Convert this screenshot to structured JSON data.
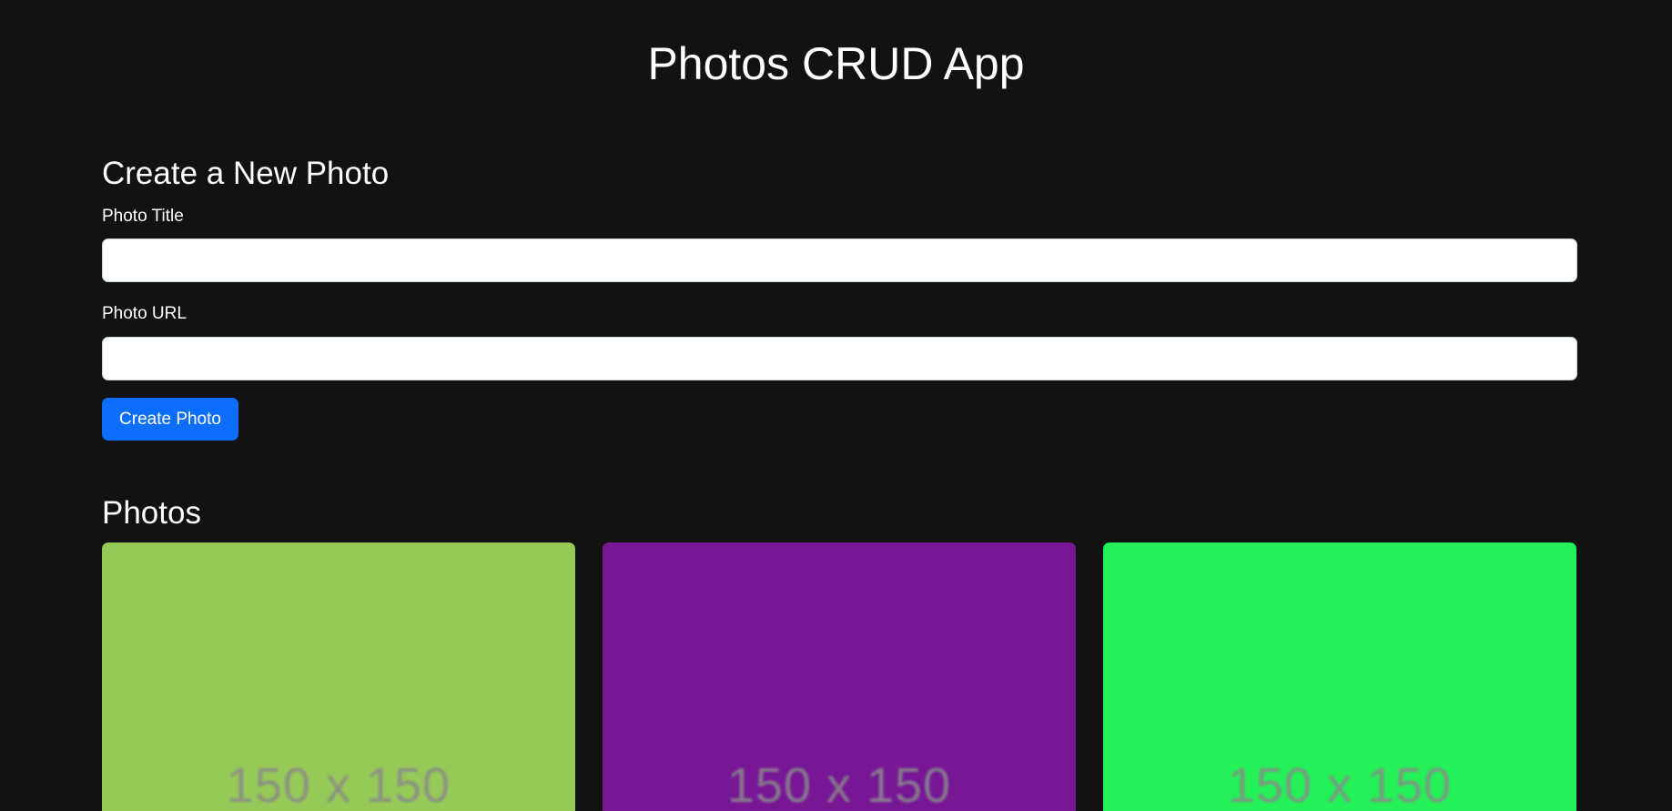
{
  "app": {
    "title": "Photos CRUD App"
  },
  "create_form": {
    "heading": "Create a New Photo",
    "title_label": "Photo Title",
    "title_value": "",
    "url_label": "Photo URL",
    "url_value": "",
    "submit_label": "Create Photo"
  },
  "photos_section": {
    "heading": "Photos",
    "items": [
      {
        "placeholder_text": "150 x 150",
        "color": "#96c957"
      },
      {
        "placeholder_text": "150 x 150",
        "color": "#771796"
      },
      {
        "placeholder_text": "150 x 150",
        "color": "#24f157"
      }
    ]
  },
  "colors": {
    "background": "#121212",
    "accent": "#0d6efd",
    "text": "#ffffff"
  }
}
